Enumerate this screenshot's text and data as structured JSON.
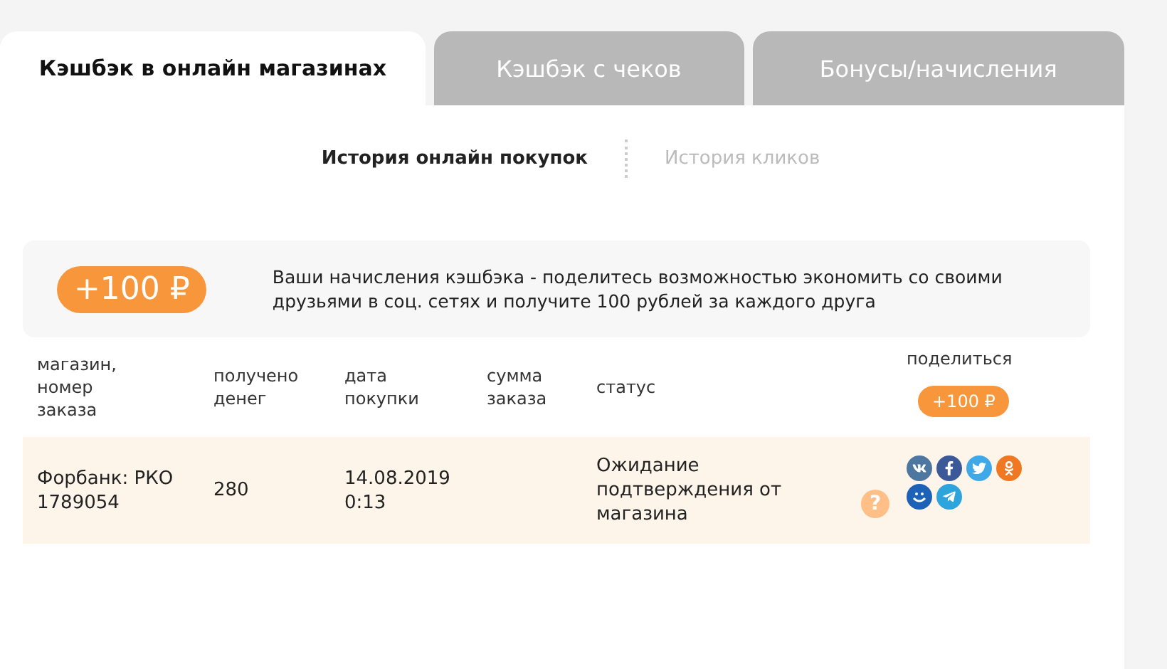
{
  "tabs": [
    {
      "label": "Кэшбэк в онлайн магазинах",
      "selected": true
    },
    {
      "label": "Кэшбэк с чеков",
      "selected": false
    },
    {
      "label": "Бонусы/начисления",
      "selected": false
    }
  ],
  "subtabs": [
    {
      "label": "История онлайн покупок",
      "selected": true
    },
    {
      "label": "История кликов",
      "selected": false
    }
  ],
  "promo": {
    "badge": "+100 ₽",
    "text": "Ваши начисления кэшбэка - поделитесь возможностью экономить со своими друзьями в соц. сетях и получите 100 рублей за каждого друга"
  },
  "table": {
    "columns": [
      "магазин, номер заказа",
      "получено денег",
      "дата покупки",
      "сумма заказа",
      "статус"
    ],
    "share_column": {
      "label": "поделиться",
      "badge": "+100 ₽"
    },
    "rows": [
      {
        "cells": [
          "Форбанк: РКО 1789054",
          "280",
          "14.08.2019 0:13",
          "",
          "Ожидание подтверждения от магазина"
        ],
        "help": "?",
        "share": [
          {
            "kind": "vk"
          },
          {
            "kind": "facebook"
          },
          {
            "kind": "twitter"
          },
          {
            "kind": "odnoklassniki"
          },
          {
            "kind": "mailru"
          },
          {
            "kind": "telegram"
          }
        ]
      }
    ]
  }
}
